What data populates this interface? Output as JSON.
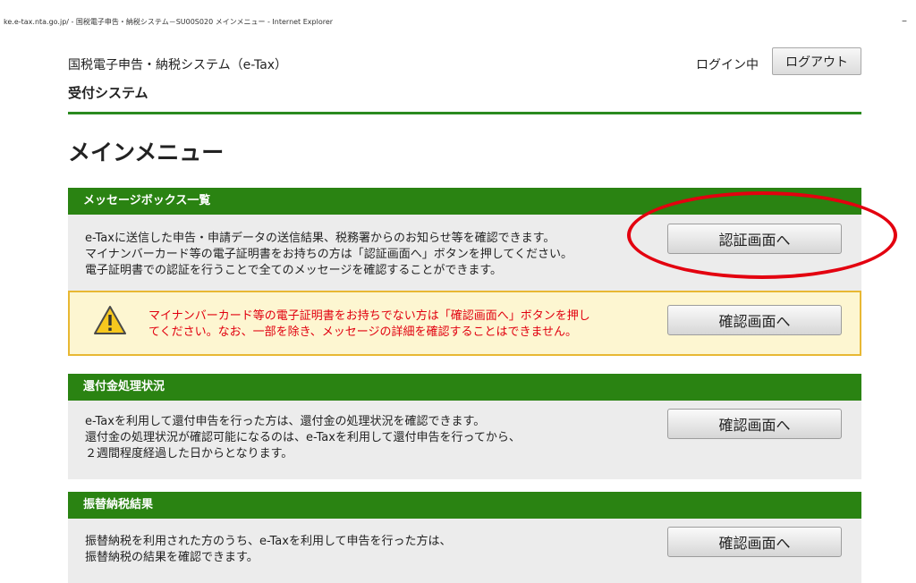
{
  "window": {
    "title": "ke.e-tax.nta.go.jp/ - 国税電子申告・納税システム－SU00S020 メインメニュー - Internet Explorer",
    "minimize_symbol": "–"
  },
  "header": {
    "system_name": "国税電子申告・納税システム（e-Tax）",
    "subsystem": "受付システム",
    "login_status": "ログイン中",
    "logout_label": "ログアウト"
  },
  "page": {
    "title": "メインメニュー"
  },
  "message_box": {
    "heading": "メッセージボックス一覧",
    "lines": [
      "e-Taxに送信した申告・申請データの送信結果、税務署からのお知らせ等を確認できます。",
      "マイナンバーカード等の電子証明書をお持ちの方は「認証画面へ」ボタンを押してください。",
      "電子証明書での認証を行うことで全てのメッセージを確認することができます。"
    ],
    "auth_button_label": "認証画面へ",
    "warning": {
      "lines": [
        "マイナンバーカード等の電子証明書をお持ちでない方は「確認画面へ」ボタンを押し",
        "てください。なお、一部を除き、メッセージの詳細を確認することはできません。"
      ],
      "button_label": "確認画面へ",
      "icon": "warning-triangle-icon",
      "text_color": "#e1000f"
    }
  },
  "refund_status": {
    "heading": "還付金処理状況",
    "lines": [
      "e-Taxを利用して還付申告を行った方は、還付金の処理状況を確認できます。",
      "還付金の処理状況が確認可能になるのは、e-Taxを利用して還付申告を行ってから、",
      "２週間程度経過した日からとなります。"
    ],
    "button_label": "確認画面へ"
  },
  "transfer_payment": {
    "heading": "振替納税結果",
    "lines": [
      "振替納税を利用された方のうち、e-Taxを利用して申告を行った方は、",
      "振替納税の結果を確認できます。"
    ],
    "button_label": "確認画面へ"
  },
  "colors": {
    "header_green": "#2a8312",
    "rule_green": "#2a8a1f",
    "panel_gray": "#ececec",
    "warning_bg": "#fdf6d1",
    "warning_border": "#e8b833",
    "highlight_red": "#e3000f"
  }
}
